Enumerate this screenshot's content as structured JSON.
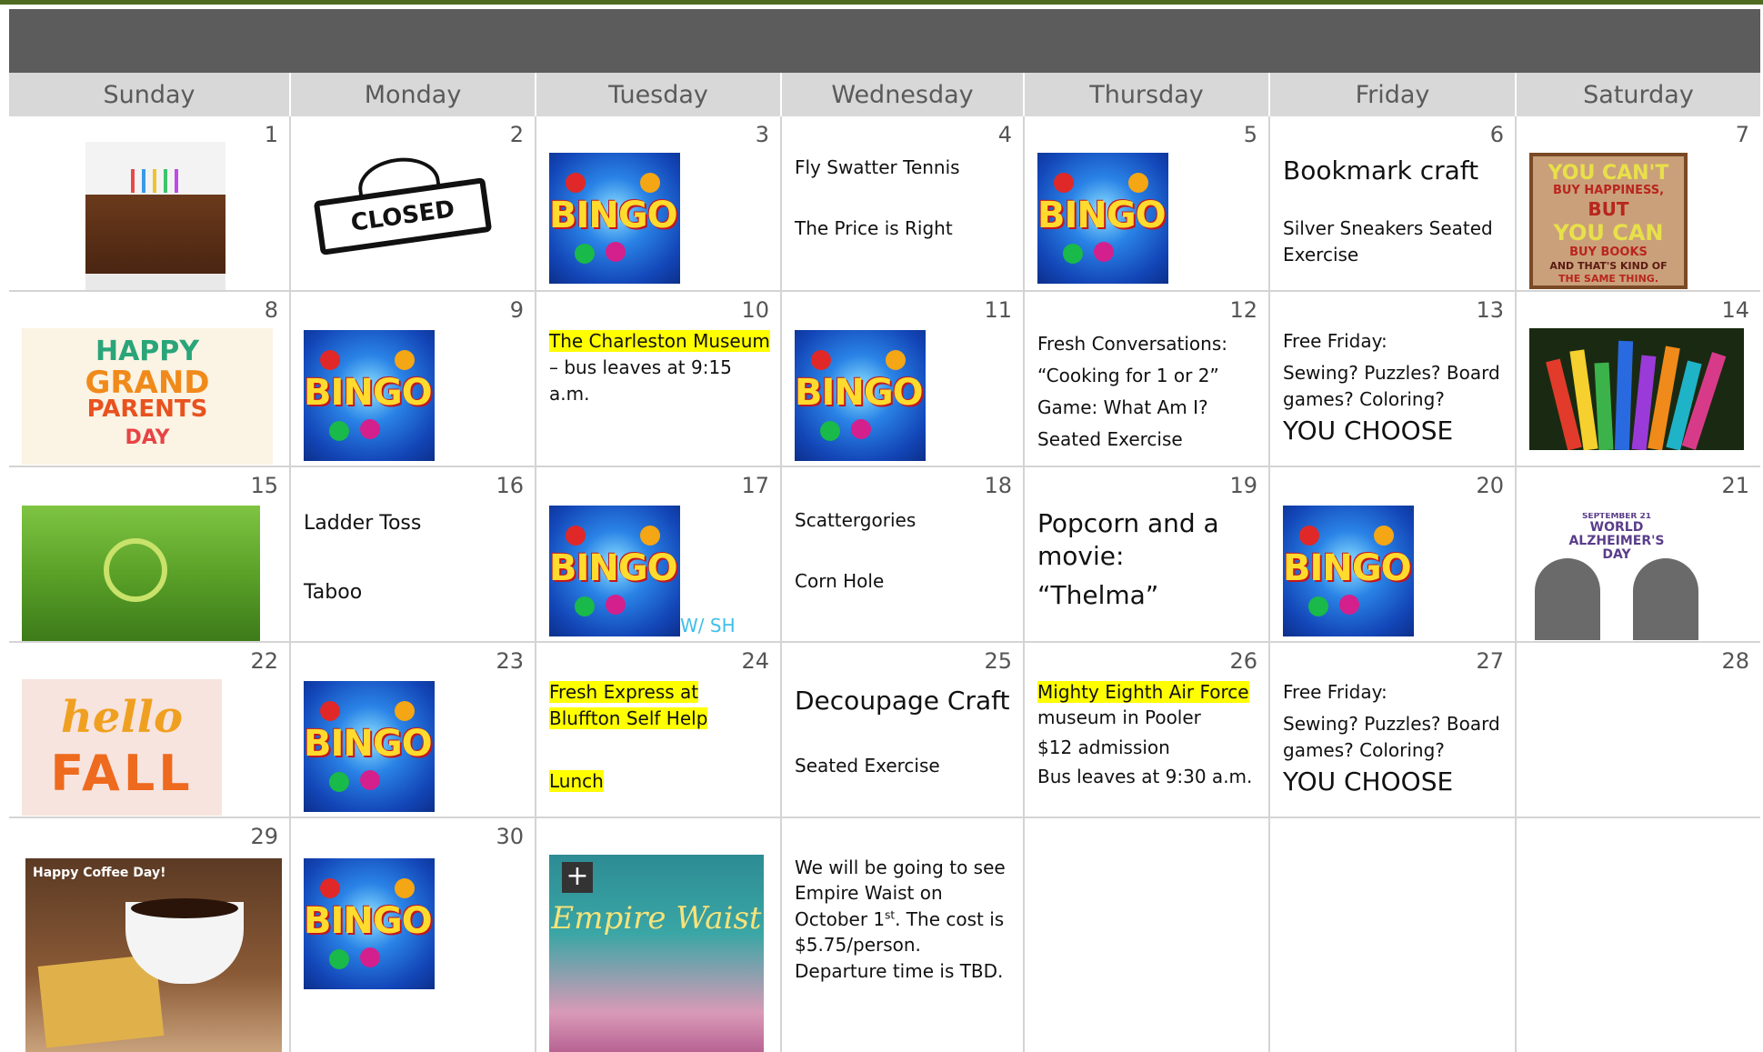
{
  "days": [
    "Sunday",
    "Monday",
    "Tuesday",
    "Wednesday",
    "Thursday",
    "Friday",
    "Saturday"
  ],
  "dates": [
    "1",
    "2",
    "3",
    "4",
    "5",
    "6",
    "7",
    "8",
    "9",
    "10",
    "11",
    "12",
    "13",
    "14",
    "15",
    "16",
    "17",
    "18",
    "19",
    "20",
    "21",
    "22",
    "23",
    "24",
    "25",
    "26",
    "27",
    "28",
    "29",
    "30"
  ],
  "bingo_word": "BINGO!",
  "closed_sign": "CLOSED",
  "happiness_sign": [
    "YOU CAN'T",
    "BUY HAPPINESS,",
    "BUT",
    "YOU CAN",
    "BUY BOOKS",
    "AND THAT'S KIND OF",
    "THE SAME THING."
  ],
  "grandparents_sign": [
    "HAPPY",
    "GRAND",
    "PARENTS",
    "DAY"
  ],
  "alz_sign": [
    "SEPTEMBER 21",
    "WORLD",
    "ALZHEIMER'S",
    "DAY"
  ],
  "fall_sign": [
    "hello",
    "FALL"
  ],
  "coffee_caption": "Happy Coffee Day!",
  "poster_title": "Empire Waist",
  "events": {
    "d4": [
      "Fly Swatter Tennis",
      "The Price is Right"
    ],
    "d6": [
      "Bookmark craft",
      "Silver Sneakers Seated Exercise"
    ],
    "d10": [
      "The Charleston Museum",
      " – bus leaves at 9:15 a.m."
    ],
    "d12": [
      "Fresh Conversations:",
      "“Cooking for 1 or 2”",
      "Game: What Am I?",
      "Seated Exercise"
    ],
    "d13": [
      "Free Friday:",
      "Sewing? Puzzles? Board games? Coloring?",
      "YOU CHOOSE"
    ],
    "d16": [
      "Ladder Toss",
      "Taboo"
    ],
    "d17": [
      "W/ SH"
    ],
    "d18": [
      "Scattergories",
      "Corn Hole"
    ],
    "d19": [
      "Popcorn and a movie:",
      "“Thelma”"
    ],
    "d24": [
      "Fresh Express at Bluffton Self Help",
      "Lunch"
    ],
    "d25": [
      "Decoupage Craft",
      "Seated Exercise"
    ],
    "d26": [
      "Mighty Eighth Air Force",
      "museum in Pooler",
      "$12 admission",
      "Bus leaves at 9:30 a.m."
    ],
    "d27": [
      "Free Friday:",
      "Sewing? Puzzles? Board games? Coloring?",
      "YOU CHOOSE"
    ],
    "d31": [
      "We will be going to see Empire Waist on October 1",
      "st",
      ". The cost is $5.75/person. Departure time is TBD."
    ]
  }
}
